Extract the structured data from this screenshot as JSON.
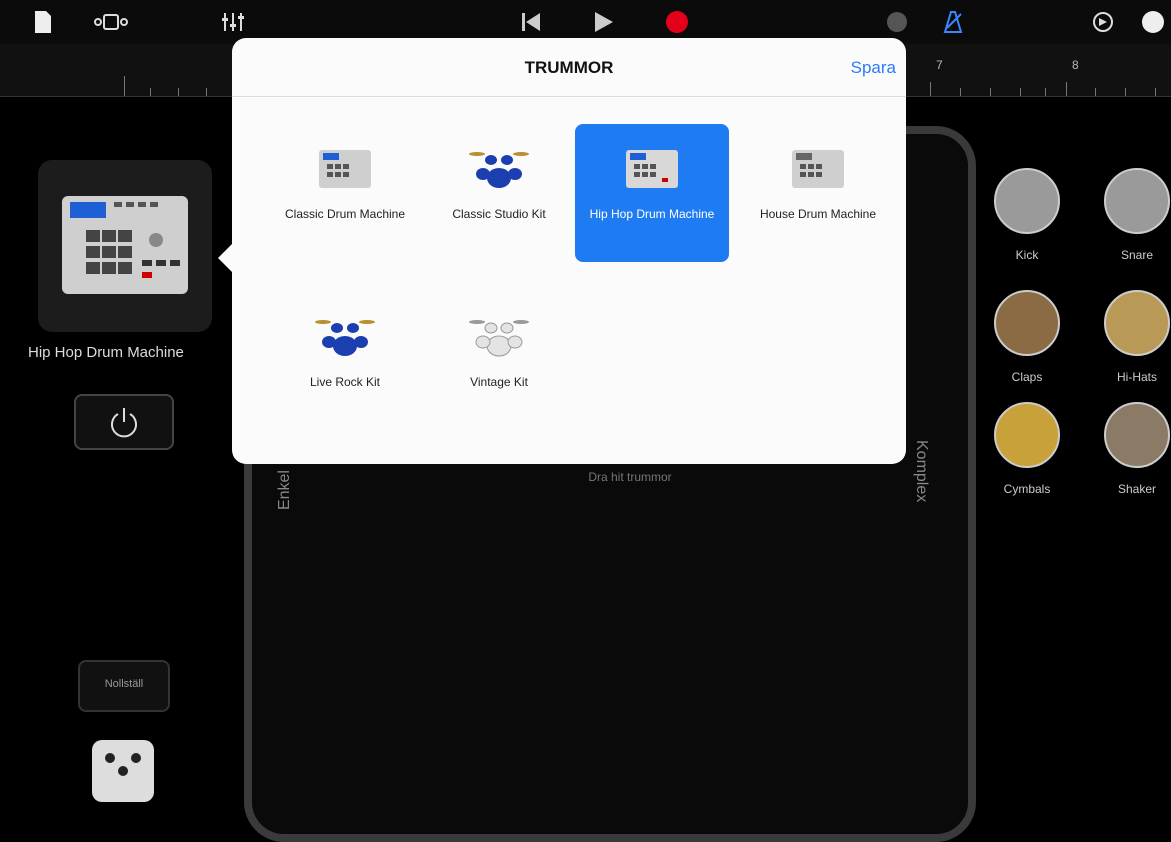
{
  "app": {
    "accent": "#1f7bf2"
  },
  "toolbar": {
    "icons": [
      "document-icon",
      "track-view-icon",
      "mixer-icon",
      "rewind-icon",
      "play-icon",
      "record-icon",
      "master-volume-icon",
      "metronome-icon",
      "settings-icon",
      "help-icon"
    ],
    "record_color": "#e5001a"
  },
  "ruler": {
    "bars": [
      "7",
      "8"
    ]
  },
  "left_panel": {
    "current_kit": "Hip Hop Drum Machine",
    "reset_label": "Nollställ"
  },
  "pad": {
    "left_label": "Enkel",
    "right_label": "Komplex",
    "drag_hint": "Dra hit trummor"
  },
  "instruments": [
    {
      "label": "Kick"
    },
    {
      "label": "Snare"
    },
    {
      "label": "Claps"
    },
    {
      "label": "Hi-Hats"
    },
    {
      "label": "Cymbals"
    },
    {
      "label": "Shaker"
    }
  ],
  "popover": {
    "title": "TRUMMOR",
    "save_label": "Spara",
    "kits": [
      {
        "label": "Classic Drum Machine",
        "type": "machine",
        "selected": false
      },
      {
        "label": "Classic Studio Kit",
        "type": "kit",
        "selected": false
      },
      {
        "label": "Hip Hop Drum Machine",
        "type": "machine",
        "selected": true
      },
      {
        "label": "House Drum Machine",
        "type": "machine",
        "selected": false
      },
      {
        "label": "Live Rock Kit",
        "type": "kit",
        "selected": false
      },
      {
        "label": "Vintage Kit",
        "type": "kit-vintage",
        "selected": false
      }
    ]
  }
}
